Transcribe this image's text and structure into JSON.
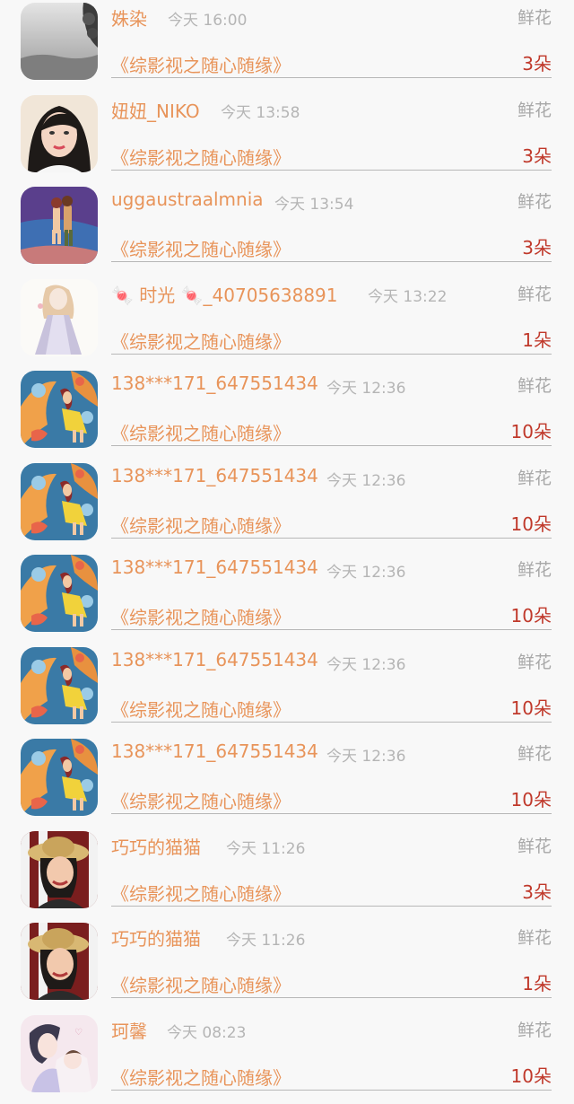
{
  "items": [
    {
      "name": "姝染",
      "time": "今天 16:00",
      "gift": "鲜花",
      "book": "《综影视之随心随缘》",
      "count": "3朵",
      "avatar": "foggy-landscape-avatar"
    },
    {
      "name": "妞妞_NIKO",
      "time": "今天 13:58",
      "gift": "鲜花",
      "book": "《综影视之随心随缘》",
      "count": "3朵",
      "avatar": "portrait-woman-avatar"
    },
    {
      "name": "uggaustraalmnia",
      "time": "今天 13:54",
      "gift": "鲜花",
      "book": "《综影视之随心随缘》",
      "count": "3朵",
      "avatar": "couple-on-beach-avatar"
    },
    {
      "name": "🍬 时光 🍬_40705638891",
      "time": "今天 13:22",
      "gift": "鲜花",
      "book": "《综影视之随心随缘》",
      "count": "1朵",
      "avatar": "illustrated-girl-dress-avatar"
    },
    {
      "name": "138***171_647551434",
      "time": "今天 12:36",
      "gift": "鲜花",
      "book": "《综影视之随心随缘》",
      "count": "10朵",
      "avatar": "cartoon-girl-blue-avatar"
    },
    {
      "name": "138***171_647551434",
      "time": "今天 12:36",
      "gift": "鲜花",
      "book": "《综影视之随心随缘》",
      "count": "10朵",
      "avatar": "cartoon-girl-blue-avatar"
    },
    {
      "name": "138***171_647551434",
      "time": "今天 12:36",
      "gift": "鲜花",
      "book": "《综影视之随心随缘》",
      "count": "10朵",
      "avatar": "cartoon-girl-blue-avatar"
    },
    {
      "name": "138***171_647551434",
      "time": "今天 12:36",
      "gift": "鲜花",
      "book": "《综影视之随心随缘》",
      "count": "10朵",
      "avatar": "cartoon-girl-blue-avatar"
    },
    {
      "name": "138***171_647551434",
      "time": "今天 12:36",
      "gift": "鲜花",
      "book": "《综影视之随心随缘》",
      "count": "10朵",
      "avatar": "cartoon-girl-blue-avatar"
    },
    {
      "name": "巧巧的猫猫",
      "time": "今天 11:26",
      "gift": "鲜花",
      "book": "《综影视之随心随缘》",
      "count": "3朵",
      "avatar": "woman-straw-hat-avatar"
    },
    {
      "name": "巧巧的猫猫",
      "time": "今天 11:26",
      "gift": "鲜花",
      "book": "《综影视之随心随缘》",
      "count": "1朵",
      "avatar": "woman-straw-hat-avatar"
    },
    {
      "name": "珂馨",
      "time": "今天 08:23",
      "gift": "鲜花",
      "book": "《综影视之随心随缘》",
      "count": "10朵",
      "avatar": "anime-couple-avatar"
    }
  ],
  "colors": {
    "name": "#e8945a",
    "count": "#c0392b",
    "time": "#b5b5b5",
    "gift": "#a8a8a8"
  }
}
